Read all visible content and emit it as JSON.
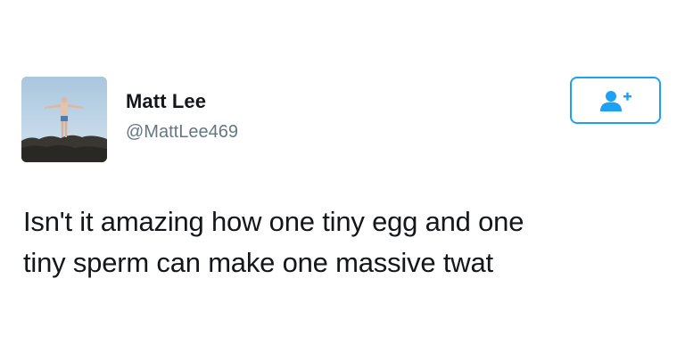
{
  "user": {
    "display_name": "Matt Lee",
    "handle": "@MattLee469",
    "avatar_icon": "profile-photo-person-on-rocks"
  },
  "follow_button": {
    "icon": "add-user-icon",
    "color": "#1da1f2"
  },
  "tweet": {
    "lines": [
      "Isn't it amazing how one tiny egg and one",
      "tiny sperm can make one massive twat"
    ]
  },
  "colors": {
    "text": "#14171a",
    "secondary_text": "#657786",
    "accent": "#1da1f2"
  }
}
